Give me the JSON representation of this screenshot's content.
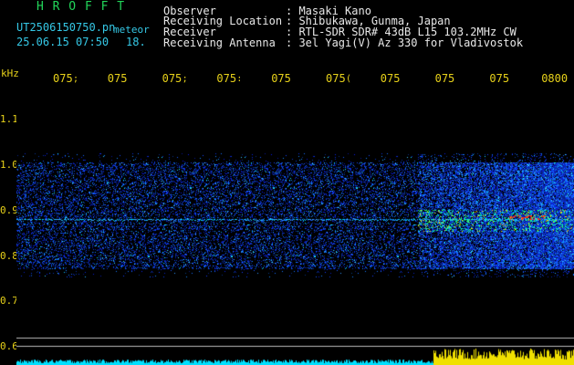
{
  "header": {
    "app_title": "H R O F F T",
    "file_name": "UT2506150750.pn",
    "file_suffix": "meteor",
    "date_time": "25.06.15 07:50",
    "seconds": "18.",
    "fields": [
      {
        "label": "Observer",
        "value": ": Masaki Kano"
      },
      {
        "label": "Receiving Location",
        "value": ": Shibukawa, Gunma, Japan"
      },
      {
        "label": "Receiver",
        "value": ": RTL-SDR SDR# 43dB L15 103.2MHz CW"
      },
      {
        "label": "Receiving Antenna",
        "value": ": 3el Yagi(V) Az 330 for Vladivostok"
      }
    ]
  },
  "axis": {
    "unit": "kHz",
    "y_ticks": [
      "1.1",
      "1.0",
      "0.9",
      "0.8",
      "0.7",
      "0.6"
    ],
    "time_ticks": [
      "075",
      "075",
      "075",
      "075",
      "075",
      "075",
      "075",
      "075",
      "075",
      "0800"
    ],
    "time_tick_marks": [
      ";",
      "",
      ";",
      ":",
      "",
      "(",
      "",
      "",
      "",
      ""
    ]
  },
  "colors": {
    "background": "#000000",
    "noise_blue": "#1a3cff",
    "signal_cyan": "#00d8ff",
    "meteor_red": "#ff3010",
    "level_cyan": "#00e0ff",
    "level_yellow": "#f0e000"
  }
}
